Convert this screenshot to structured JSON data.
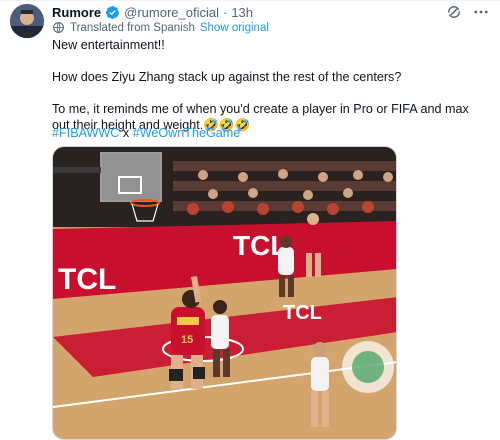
{
  "post": {
    "author_name": "Rumore",
    "author_handle": "@rumore_oficial",
    "separator": "·",
    "time": "13h",
    "translated_label": "Translated from Spanish",
    "show_original_label": "Show original",
    "paragraphs": [
      "New entertainment!!",
      "How does Ziyu Zhang stack up against the rest of the centers?",
      "To me, it reminds me of when you'd create a player in Pro or FIFA and max out their height and weight.🤣🤣🤣"
    ],
    "hashtag_1": "#FIBAWWC",
    "hashtag_sep": " x ",
    "hashtag_2": "#WeOwnTheGame"
  },
  "media": {
    "sponsor_text": "TCL",
    "jersey_number": "15"
  },
  "icons": {
    "verified": "verified-badge-icon",
    "grok": "grok-icon",
    "more": "more-options-icon",
    "translate": "translate-globe-icon"
  },
  "colors": {
    "link": "#1d9bf0",
    "secondary_text": "#536471",
    "court_red": "#c8102e"
  }
}
